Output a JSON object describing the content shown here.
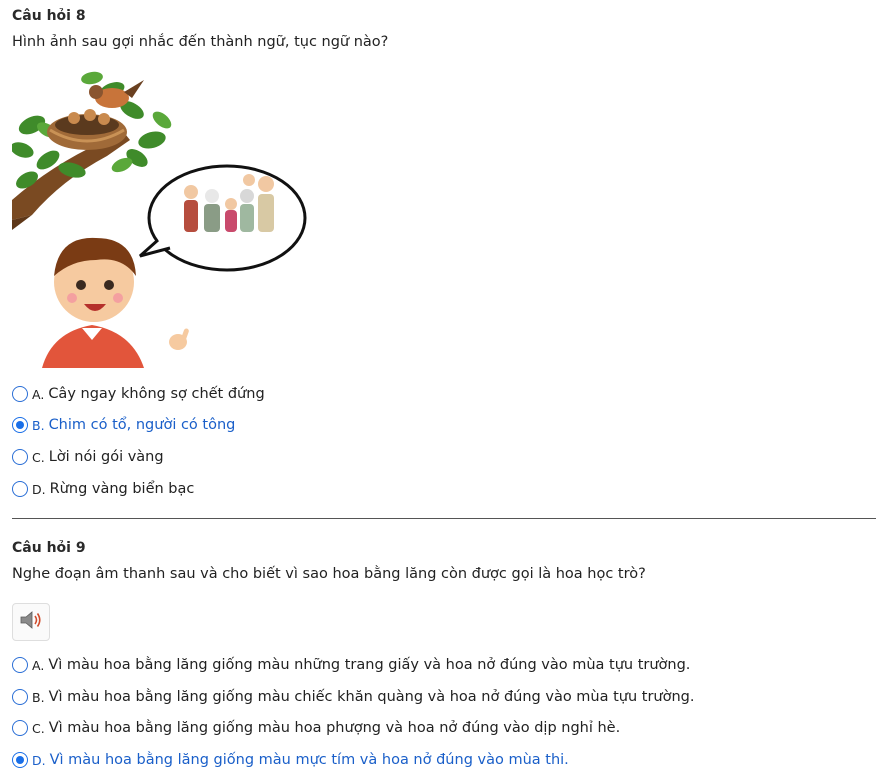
{
  "q8": {
    "title": "Câu hỏi 8",
    "text": "Hình ảnh sau gợi nhắc đến thành ngữ, tục ngữ nào?",
    "options": [
      {
        "letter": "A.",
        "text": "Cây ngay không sợ chết đứng",
        "selected": false
      },
      {
        "letter": "B.",
        "text": "Chim có tổ, người có tông",
        "selected": true
      },
      {
        "letter": "C.",
        "text": "Lời nói gói vàng",
        "selected": false
      },
      {
        "letter": "D.",
        "text": "Rừng vàng biển bạc",
        "selected": false
      }
    ]
  },
  "q9": {
    "title": "Câu hỏi 9",
    "text": "Nghe đoạn âm thanh sau và cho biết vì sao hoa bằng lăng còn được gọi là hoa học trò?",
    "audio_icon": "speaker-icon",
    "options": [
      {
        "letter": "A.",
        "text": "Vì màu hoa bằng lăng giống màu những trang giấy và hoa nở đúng vào mùa tựu trường.",
        "selected": false
      },
      {
        "letter": "B.",
        "text": "Vì màu hoa bằng lăng giống màu chiếc khăn quàng và hoa nở đúng vào mùa tựu trường.",
        "selected": false
      },
      {
        "letter": "C.",
        "text": "Vì màu hoa bằng lăng giống màu hoa phượng và hoa nở đúng vào dịp nghỉ hè.",
        "selected": false
      },
      {
        "letter": "D.",
        "text": "Vì màu hoa bằng lăng giống màu mực tím và hoa nở đúng vào mùa thi.",
        "selected": true
      }
    ]
  },
  "colors": {
    "accent": "#1a6fe8",
    "selected_text": "#1a5fc9",
    "divider": "#555555"
  }
}
